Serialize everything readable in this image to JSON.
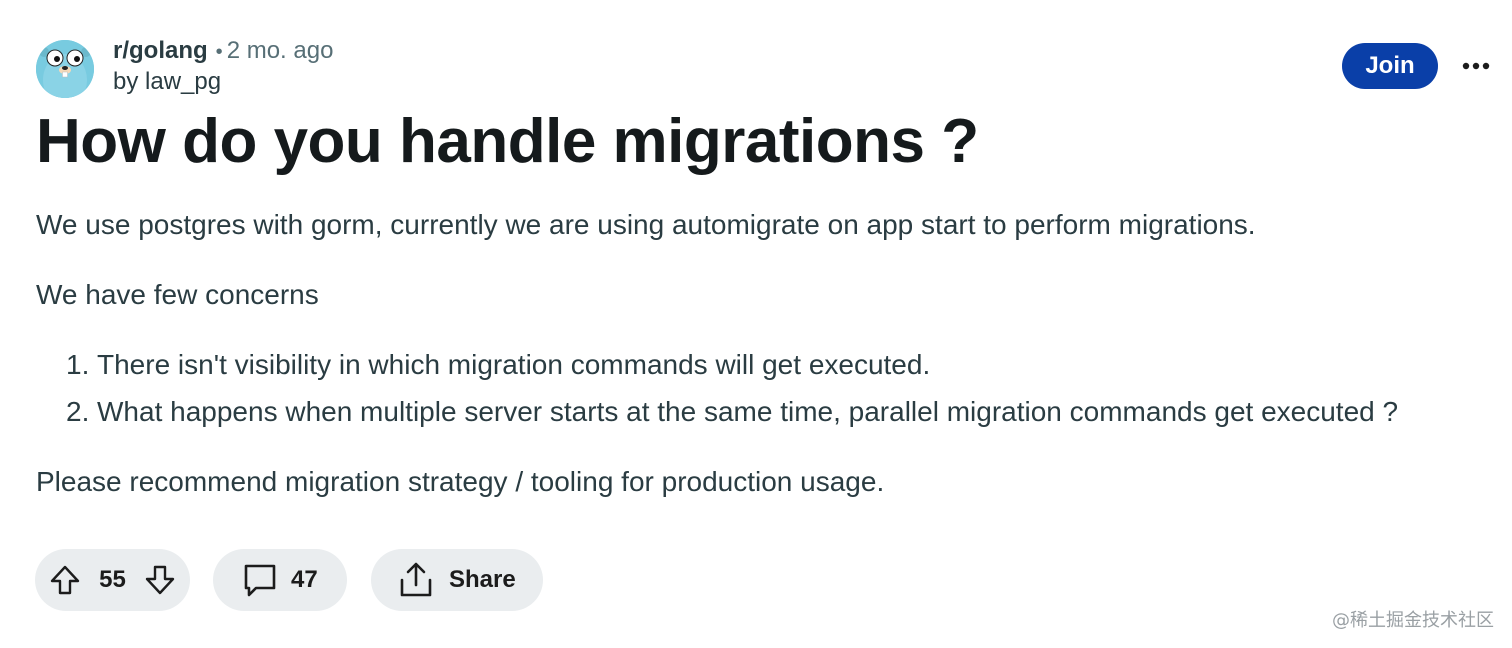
{
  "post": {
    "subreddit": "r/golang",
    "separator": "•",
    "time_ago": "2 mo. ago",
    "author_line": "by law_pg",
    "title": "How do you handle migrations ?",
    "paragraphs": [
      "We use postgres with gorm, currently we are using automigrate on app start to perform migrations.",
      "We have few concerns",
      "Please recommend migration strategy / tooling for production usage."
    ],
    "list": [
      {
        "number": "1.",
        "text": "There isn't visibility in which migration commands will get executed."
      },
      {
        "number": "2.",
        "text": "What happens when multiple server starts at the same time, parallel migration commands get executed ?"
      }
    ]
  },
  "header": {
    "join_label": "Join",
    "more_icon": "more-horizontal-icon",
    "avatar_icon": "gopher-avatar"
  },
  "actions": {
    "upvotes": "55",
    "comments": "47",
    "share_label": "Share",
    "icons": [
      "upvote-arrow-icon",
      "downvote-arrow-icon",
      "comment-bubble-icon",
      "share-icon"
    ]
  },
  "watermark": "@稀土掘金技术社区",
  "colors": {
    "join_button": "#0a3fa8",
    "pill_background": "#eaedef",
    "title_text": "#151a1c",
    "body_text": "#2a3c42",
    "meta_text": "#576f76",
    "avatar_bg": "#78cbe0"
  }
}
